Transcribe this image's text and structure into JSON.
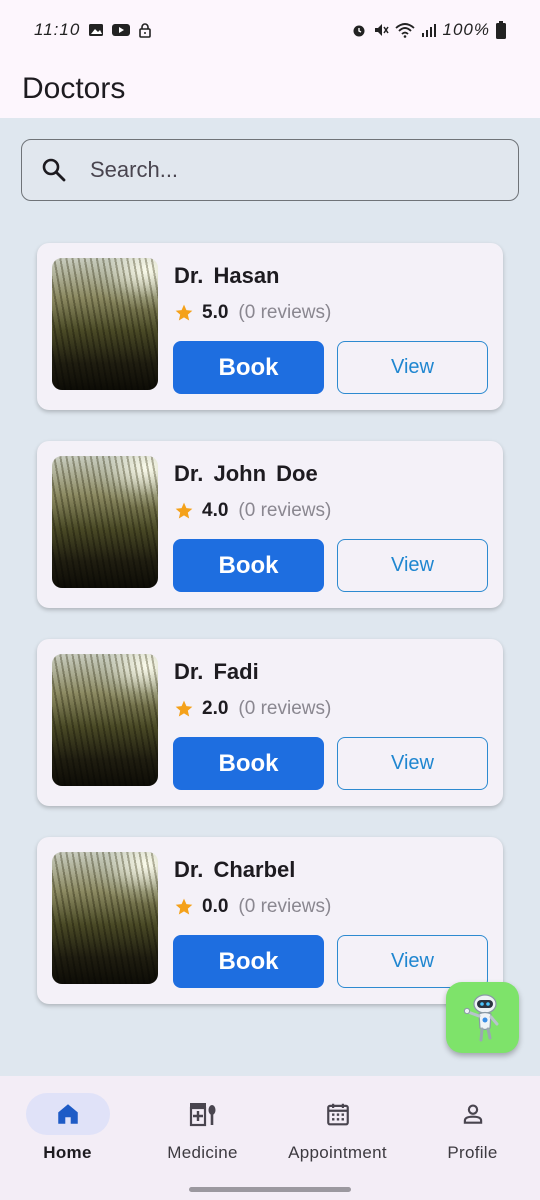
{
  "status_bar": {
    "time": "11:10",
    "battery": "100%",
    "left_icons": [
      "gallery-icon",
      "youtube-icon",
      "lock-icon"
    ],
    "right_icons": [
      "alarm-icon",
      "mute-icon",
      "wifi-icon",
      "signal-icon",
      "battery-icon"
    ]
  },
  "app_bar": {
    "title": "Doctors"
  },
  "search": {
    "placeholder": "Search...",
    "value": ""
  },
  "doctors": [
    {
      "name": "Dr.  Hasan",
      "rating": "5.0",
      "reviews": "(0 reviews)",
      "book_label": "Book",
      "view_label": "View"
    },
    {
      "name": "Dr.  John Doe",
      "rating": "4.0",
      "reviews": "(0 reviews)",
      "book_label": "Book",
      "view_label": "View"
    },
    {
      "name": "Dr.  Fadi",
      "rating": "2.0",
      "reviews": "(0 reviews)",
      "book_label": "Book",
      "view_label": "View"
    },
    {
      "name": "Dr.  Charbel",
      "rating": "0.0",
      "reviews": "(0 reviews)",
      "book_label": "Book",
      "view_label": "View"
    }
  ],
  "fab": {
    "icon": "robot-assistant-icon"
  },
  "bottom_nav": [
    {
      "label": "Home",
      "icon": "home-icon",
      "active": true
    },
    {
      "label": "Medicine",
      "icon": "medicine-icon",
      "active": false
    },
    {
      "label": "Appointment",
      "icon": "calendar-icon",
      "active": false
    },
    {
      "label": "Profile",
      "icon": "profile-icon",
      "active": false
    }
  ],
  "colors": {
    "primary": "#1e6ee0",
    "accent_star": "#f4a11a",
    "background": "#dfe7ef",
    "card": "#f4f1f8",
    "fab": "#7ee36a"
  }
}
